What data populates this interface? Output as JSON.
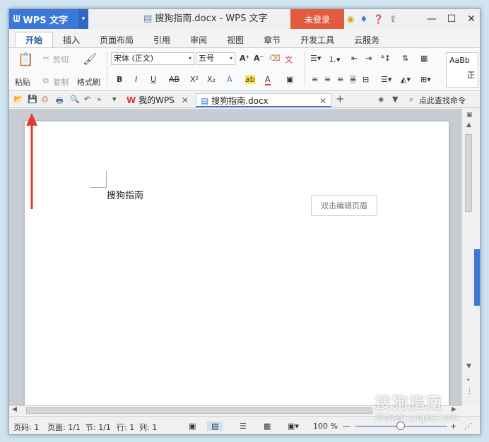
{
  "titlebar": {
    "app_name": "WPS 文字",
    "doc_title": "搜狗指南.docx - WPS 文字",
    "login_label": "未登录"
  },
  "ribbon_tabs": [
    "开始",
    "插入",
    "页面布局",
    "引用",
    "审阅",
    "视图",
    "章节",
    "开发工具",
    "云服务"
  ],
  "ribbon": {
    "paste": "粘贴",
    "cut": "剪切",
    "copy": "复制",
    "format_painter": "格式刷",
    "font_name": "宋体 (正文)",
    "font_size": "五号",
    "style_preview": "AaBb",
    "style_name": "正"
  },
  "doc_tabs": {
    "my_wps": "我的WPS",
    "current_doc": "搜狗指南.docx",
    "search_command": "点此查找命令"
  },
  "document": {
    "body_text": "搜狗指南",
    "header_hint": "双击编辑页眉"
  },
  "status": {
    "page_num": "页码: 1",
    "pages": "页面: 1/1",
    "section": "节: 1/1",
    "row": "行: 1",
    "col": "列: 1",
    "zoom": "100 %"
  },
  "watermark": {
    "brand": "搜狗指南",
    "url": "zhinan.sogou.com"
  },
  "colors": {
    "accent": "#3b78d8",
    "login": "#e25b3f",
    "annotation": "#e53935"
  }
}
